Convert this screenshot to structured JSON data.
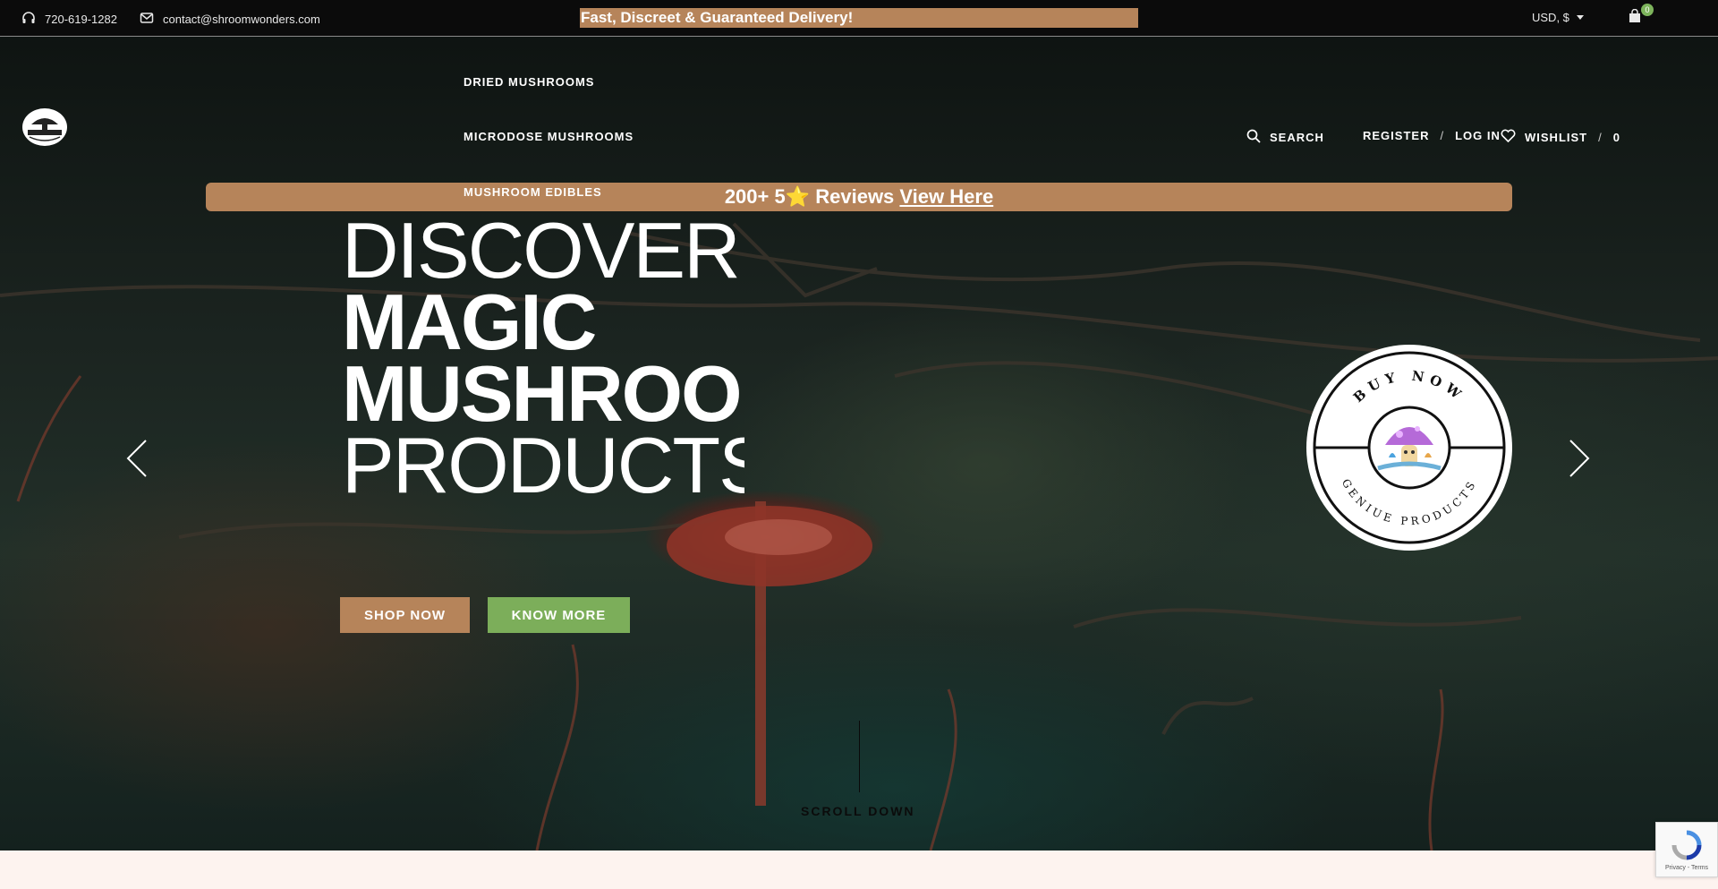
{
  "topbar": {
    "phone": "720-619-1282",
    "email": "contact@shroomwonders.com",
    "promo": "Fast, Discreet & Guaranteed Delivery!",
    "currency": "USD, $",
    "cart_count": "0"
  },
  "header": {
    "nav": {
      "dried": "DRIED MUSHROOMS",
      "microdose": "MICRODOSE MUSHROOMS",
      "edibles": "MUSHROOM EDIBLES"
    },
    "search_label": "SEARCH",
    "register_label": "REGISTER",
    "login_label": "LOG IN",
    "slash": "/",
    "wishlist_label": "WISHLIST",
    "wishlist_count": "0"
  },
  "reviews_bar": {
    "text": "200+ 5",
    "star": "⭐",
    "reviews_word": " Reviews ",
    "link": "View Here"
  },
  "hero": {
    "line1": "DISCOVER",
    "line2": "MAGIC",
    "line3": "MUSHROOMS",
    "line4": "PRODUCTS",
    "shop_button": "SHOP NOW",
    "know_button": "KNOW MORE",
    "badge_top": "BUY NOW",
    "badge_bottom": "GENIUE PRODUCTS",
    "scroll_label": "SCROLL DOWN"
  },
  "recaptcha": {
    "links": "Privacy - Terms"
  },
  "colors": {
    "accent_tan": "#b6845a",
    "accent_green": "#7cae5a",
    "topbar_bg": "#0b0b0b"
  }
}
